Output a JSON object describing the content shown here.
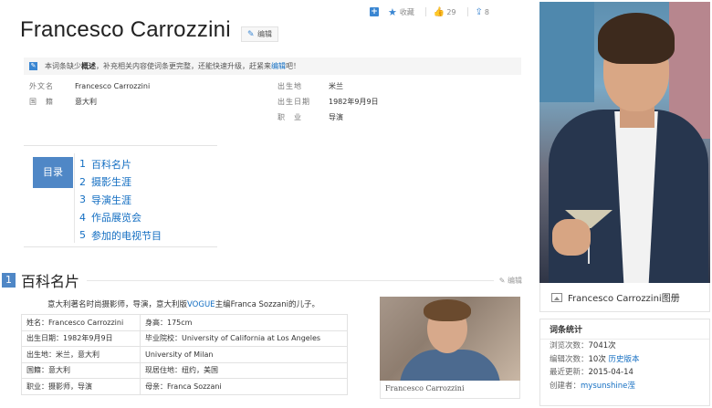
{
  "toolbar": {
    "add_icon": "plus-square-icon",
    "favorite_label": "收藏",
    "like_count": "29",
    "share_count": "8"
  },
  "title": "Francesco Carrozzini",
  "edit_label": "编辑",
  "notice": {
    "prefix": "本词条缺少",
    "bold": "概述",
    "middle": "，补充相关内容使词条更完整，还能快速升级，赶紧来",
    "link": "编辑",
    "suffix": "吧！"
  },
  "basic_info": [
    {
      "k1": "外文名",
      "v1": "Francesco Carrozzini",
      "k2": "出生地",
      "v2": "米兰"
    },
    {
      "k1": "国　籍",
      "v1": "意大利",
      "k2": "出生日期",
      "v2": "1982年9月9日"
    },
    {
      "k1": "",
      "v1": "",
      "k2": "职　业",
      "v2": "导演"
    }
  ],
  "toc": {
    "label": "目录",
    "items": [
      {
        "n": "1",
        "label": "百科名片"
      },
      {
        "n": "2",
        "label": "摄影生涯"
      },
      {
        "n": "3",
        "label": "导演生涯"
      },
      {
        "n": "4",
        "label": "作品展览会"
      },
      {
        "n": "5",
        "label": "参加的电视节目"
      }
    ]
  },
  "section": {
    "num": "1",
    "title": "百科名片",
    "edit": "编辑"
  },
  "intro": {
    "before": "意大利著名时尚摄影师，导演，意大利版",
    "link": "VOGUE",
    "after": "主编Franca Sozzani的儿子。"
  },
  "info_table": [
    [
      "姓名：Francesco Carrozzini",
      "身高：175cm"
    ],
    [
      "出生日期：1982年9月9日",
      "毕业院校：University of California at Los Angeles"
    ],
    [
      "出生地：米兰，意大利",
      "University of Milan"
    ],
    [
      "国籍：意大利",
      "现居住地：纽约，美国"
    ],
    [
      "职业：摄影师，导演",
      "母亲：Franca Sozzani"
    ]
  ],
  "photo_caption": "Francesco Carrozzini",
  "side_caption": "Francesco Carrozzini图册",
  "stats": {
    "header": "词条统计",
    "views_label": "浏览次数：",
    "views": "7041次",
    "edits_label": "编辑次数：",
    "edits": "10次",
    "history_link": "历史版本",
    "updated_label": "最近更新：",
    "updated": "2015-04-14",
    "creator_label": "创建者：",
    "creator": "mysunshine滢"
  }
}
